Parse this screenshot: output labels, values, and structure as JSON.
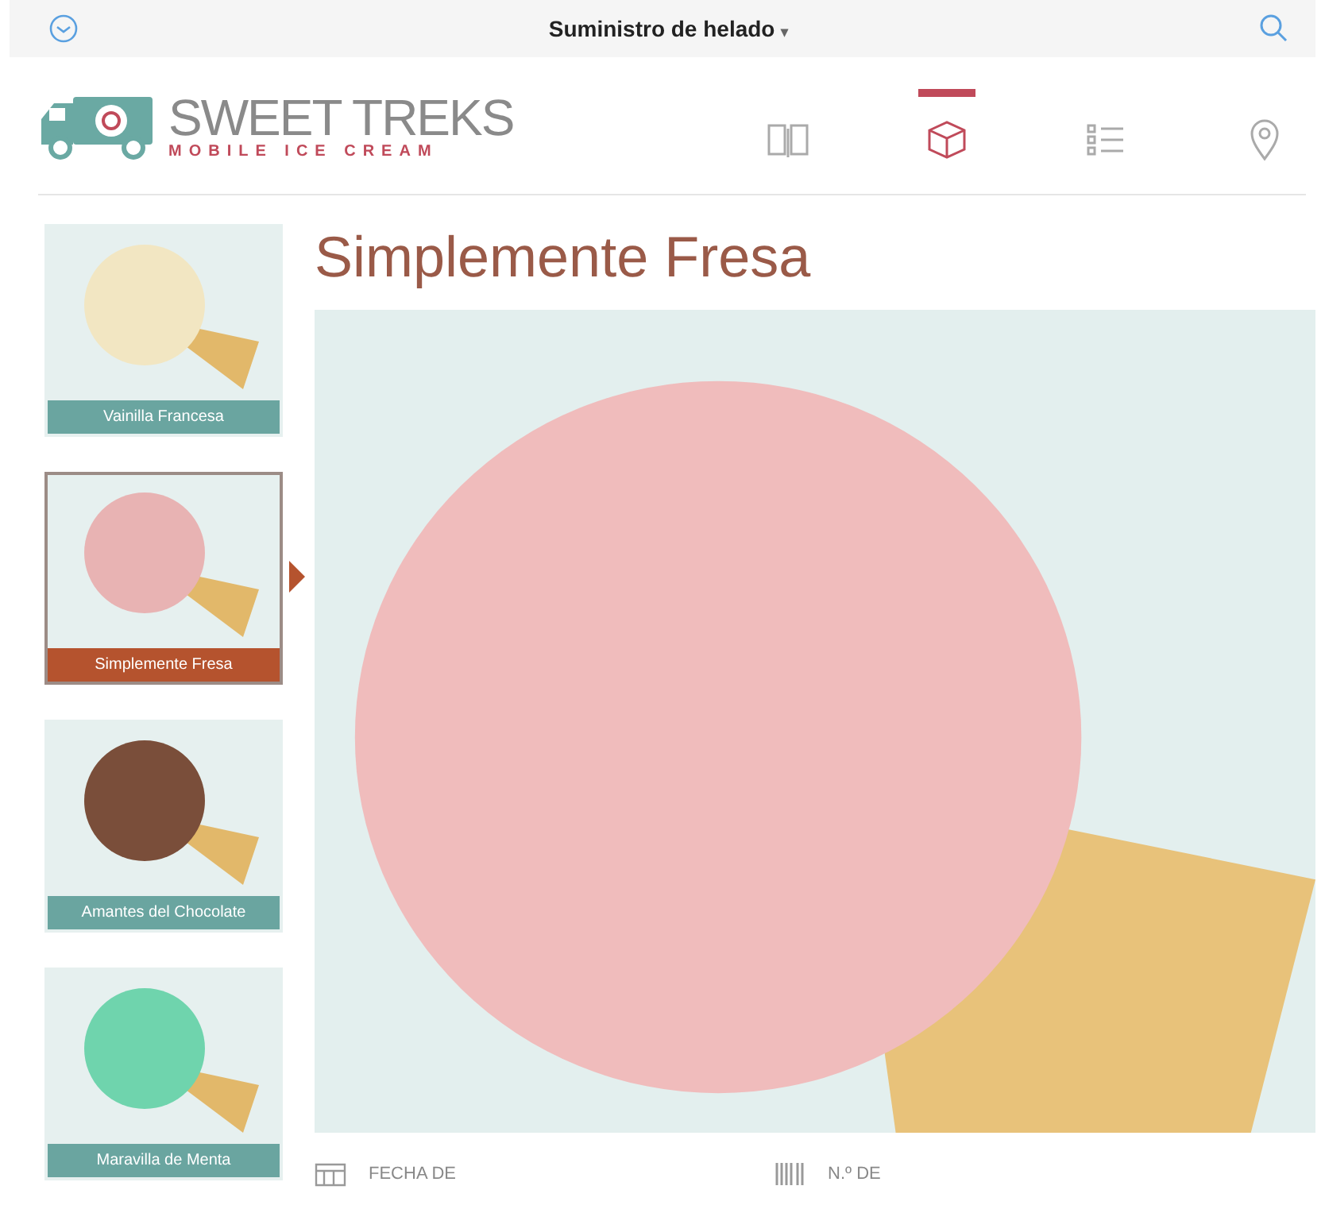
{
  "top_bar": {
    "title": "Suministro de helado",
    "caret": "▾"
  },
  "brand": {
    "name": "SWEET TREKS",
    "tagline": "MOBILE ICE CREAM"
  },
  "nav": [
    {
      "kind": "book",
      "selected": false
    },
    {
      "kind": "box",
      "selected": true
    },
    {
      "kind": "list",
      "selected": false
    },
    {
      "kind": "pin",
      "selected": false
    }
  ],
  "flavors": [
    {
      "label": "Vainilla Francesa",
      "color": "#f2e6c2",
      "selected": false
    },
    {
      "label": "Simplemente Fresa",
      "color": "#e8b3b3",
      "selected": true
    },
    {
      "label": "Amantes del Chocolate",
      "color": "#7a4e3a",
      "selected": false
    },
    {
      "label": "Maravilla de Menta",
      "color": "#6fd4ad",
      "selected": false
    }
  ],
  "detail": {
    "title": "Simplemente Fresa",
    "color": "#f0bcbc"
  },
  "fields": [
    {
      "kind": "calendar",
      "label": "FECHA DE"
    },
    {
      "kind": "barcode",
      "label": "N.º DE"
    }
  ]
}
